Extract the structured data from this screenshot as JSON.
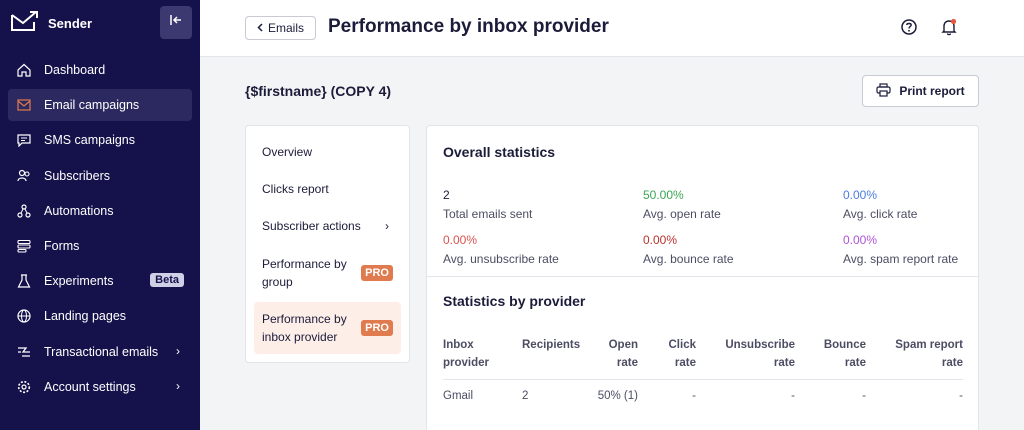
{
  "app": {
    "name": "Sender"
  },
  "sidebar": {
    "items": [
      {
        "label": "Dashboard",
        "icon": "home-icon"
      },
      {
        "label": "Email campaigns",
        "icon": "mail-icon",
        "active": true
      },
      {
        "label": "SMS campaigns",
        "icon": "chat-icon"
      },
      {
        "label": "Subscribers",
        "icon": "users-icon"
      },
      {
        "label": "Automations",
        "icon": "automation-icon"
      },
      {
        "label": "Forms",
        "icon": "forms-icon"
      },
      {
        "label": "Experiments",
        "icon": "flask-icon",
        "badge": "Beta"
      },
      {
        "label": "Landing pages",
        "icon": "globe-icon"
      },
      {
        "label": "Transactional emails",
        "icon": "bolt-icon",
        "chevron": "›"
      },
      {
        "label": "Account settings",
        "icon": "gear-icon",
        "chevron": "›"
      }
    ]
  },
  "header": {
    "back_label": "Emails",
    "title": "Performance by inbox provider"
  },
  "campaign": {
    "name": "{$firstname} (COPY 4)"
  },
  "print_label": "Print report",
  "report_nav": {
    "overview": "Overview",
    "clicks": "Clicks report",
    "subscriber_actions": "Subscriber actions",
    "perf_group_1": "Performance by",
    "perf_group_2": "group",
    "perf_inbox_1": "Performance by",
    "perf_inbox_2": "inbox provider",
    "pro": "PRO",
    "chevron": "›"
  },
  "overall": {
    "title": "Overall statistics",
    "stats": [
      {
        "value": "2",
        "label": "Total emails sent",
        "color": "#1b1b3a"
      },
      {
        "value": "50.00%",
        "label": "Avg. open rate",
        "color": "#3aa657"
      },
      {
        "value": "0.00%",
        "label": "Avg. click rate",
        "color": "#4b7de0"
      },
      {
        "value": "0.00%",
        "label": "Avg. unsubscribe rate",
        "color": "#d9534f"
      },
      {
        "value": "0.00%",
        "label": "Avg. bounce rate",
        "color": "#b8322f"
      },
      {
        "value": "0.00%",
        "label": "Avg. spam report rate",
        "color": "#b054d6"
      }
    ]
  },
  "provider": {
    "title": "Statistics by provider",
    "headers": {
      "inbox_1": "Inbox",
      "inbox_2": "provider",
      "recipients": "Recipients",
      "open_1": "Open",
      "open_2": "rate",
      "click_1": "Click",
      "click_2": "rate",
      "unsub_1": "Unsubscribe",
      "unsub_2": "rate",
      "bounce_1": "Bounce",
      "bounce_2": "rate",
      "spam_1": "Spam report",
      "spam_2": "rate"
    },
    "rows": [
      {
        "provider": "Gmail",
        "recipients": "2",
        "open": "50% (1)",
        "click": "-",
        "unsub": "-",
        "bounce": "-",
        "spam": "-"
      }
    ]
  }
}
